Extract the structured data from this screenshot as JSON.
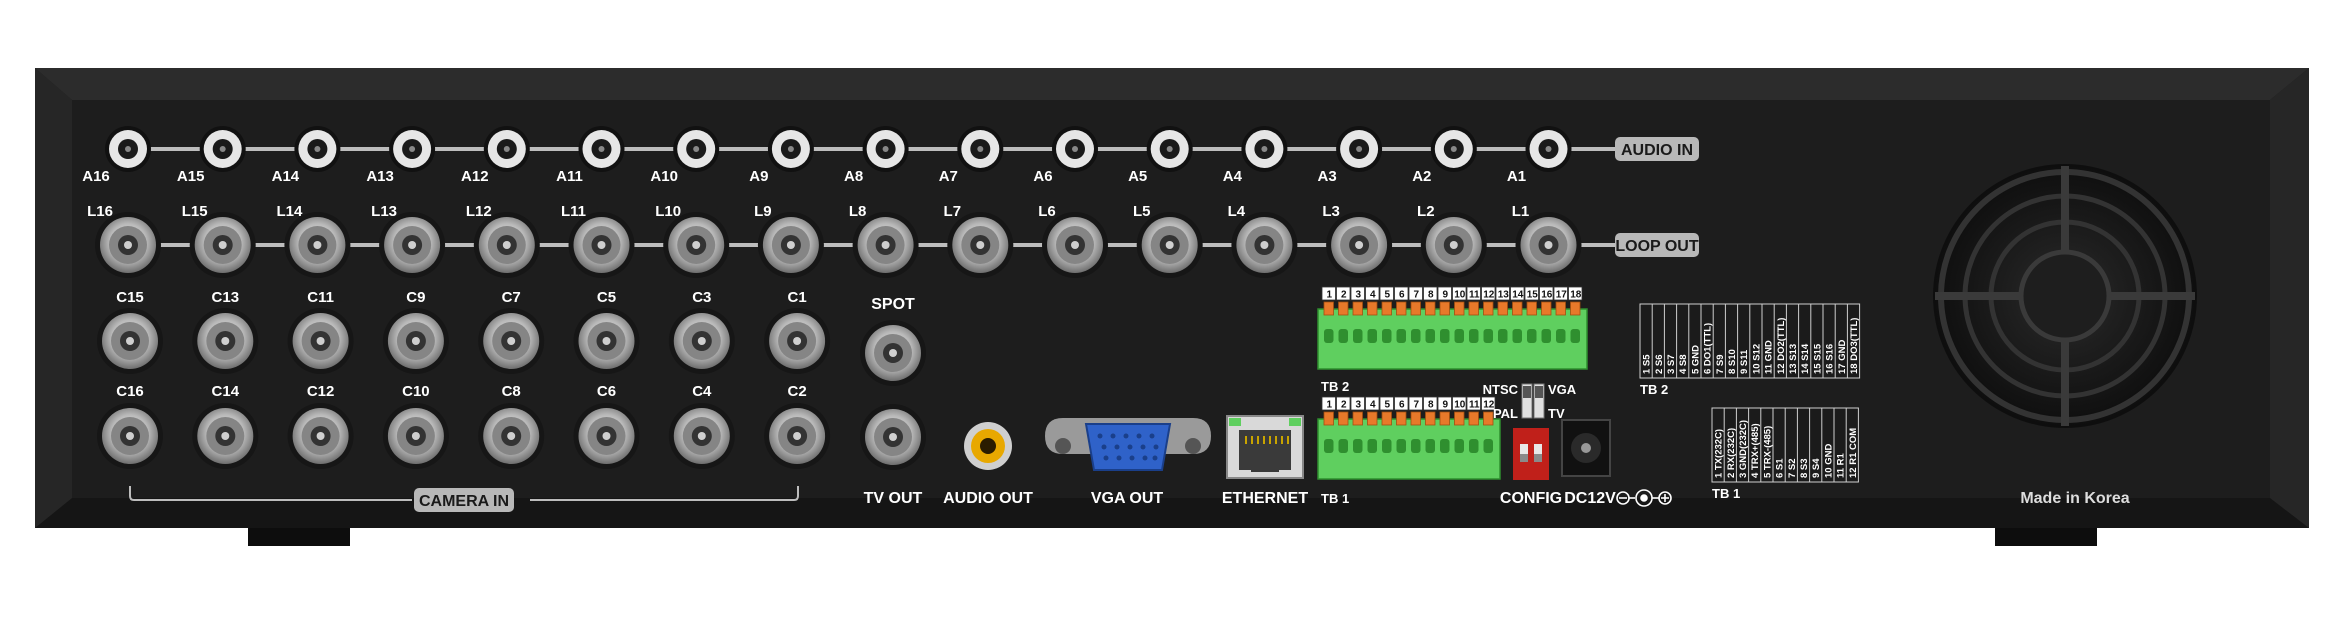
{
  "audio_in": {
    "label": "AUDIO IN",
    "ports": [
      "A16",
      "A15",
      "A14",
      "A13",
      "A12",
      "A11",
      "A10",
      "A9",
      "A8",
      "A7",
      "A6",
      "A5",
      "A4",
      "A3",
      "A2",
      "A1"
    ]
  },
  "loop_out": {
    "label": "LOOP OUT",
    "ports": [
      "L16",
      "L15",
      "L14",
      "L13",
      "L12",
      "L11",
      "L10",
      "L9",
      "L8",
      "L7",
      "L6",
      "L5",
      "L4",
      "L3",
      "L2",
      "L1"
    ]
  },
  "camera_in": {
    "label": "CAMERA IN",
    "top_row": [
      "C15",
      "C13",
      "C11",
      "C9",
      "C7",
      "C5",
      "C3",
      "C1"
    ],
    "bottom_row": [
      "C16",
      "C14",
      "C12",
      "C10",
      "C8",
      "C6",
      "C4",
      "C2"
    ]
  },
  "outputs": {
    "spot": "SPOT",
    "tv_out": "TV OUT",
    "audio_out": "AUDIO OUT",
    "vga_out": "VGA OUT",
    "ethernet": "ETHERNET"
  },
  "terminal_blocks": {
    "tb2_label": "TB 2",
    "tb1_label": "TB 1",
    "tb2_pins": [
      "1",
      "2",
      "3",
      "4",
      "5",
      "6",
      "7",
      "8",
      "9",
      "10",
      "11",
      "12",
      "13",
      "14",
      "15",
      "16",
      "17",
      "18"
    ],
    "tb1_pins": [
      "1",
      "2",
      "3",
      "4",
      "5",
      "6",
      "7",
      "8",
      "9",
      "10",
      "11",
      "12"
    ]
  },
  "config": {
    "ntsc": "NTSC",
    "pal": "PAL",
    "vga": "VGA",
    "tv": "TV",
    "config_label": "CONFIG",
    "power_label": "DC12V"
  },
  "tb2_table": {
    "title": "TB 2",
    "entries": [
      "1 S5",
      "2 S6",
      "3 S7",
      "4 S8",
      "5 GND",
      "6 DO1(TTL)",
      "7 S9",
      "8 S10",
      "9 S11",
      "10 S12",
      "11 GND",
      "12 DO2(TTL)",
      "13 S13",
      "14 S14",
      "15 S15",
      "16 S16",
      "17 GND",
      "18 DO3(TTL)"
    ]
  },
  "tb1_table": {
    "title": "TB 1",
    "entries": [
      "1 TX(232C)",
      "2 RX(232C)",
      "3 GND(232C)",
      "4 TRX+(485)",
      "5 TRX-(485)",
      "6 S1",
      "7 S2",
      "8 S3",
      "9 S4",
      "10 GND",
      "11 R1",
      "12 R1 COM"
    ]
  },
  "footer": {
    "made_in": "Made in Korea"
  },
  "colors": {
    "chassis": "#1b1b1b",
    "terminal_green": "#5fcf5f",
    "terminal_orange": "#e8792a",
    "vga_blue": "#2f62c9",
    "audio_yellow": "#e8a800",
    "config_red": "#c0201a"
  }
}
